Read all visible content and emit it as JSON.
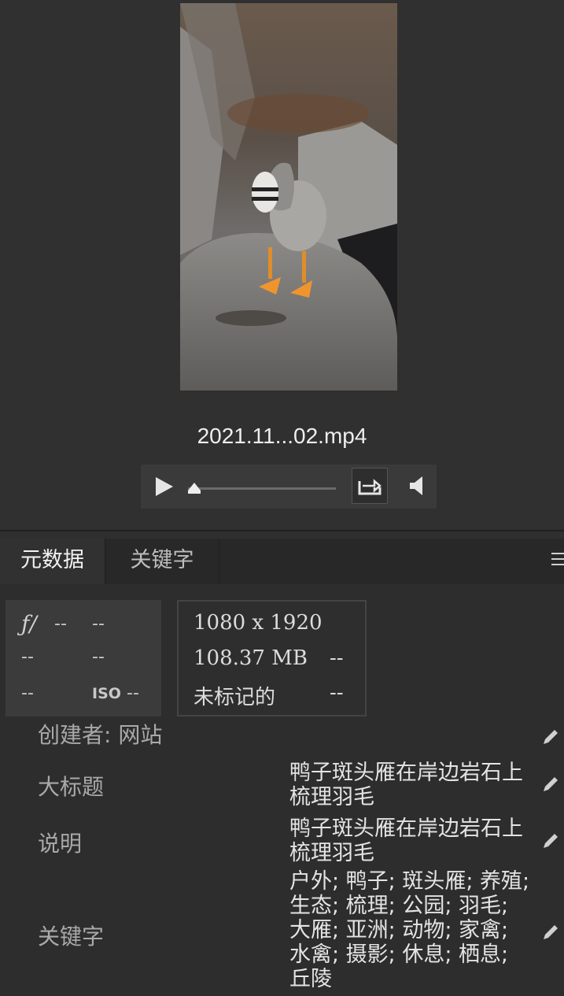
{
  "preview": {
    "filename": "2021.11...02.mp4",
    "thumbnail": "bar-headed goose on rock photo",
    "playback_progress": 0.03
  },
  "player": {
    "play_icon": "play-icon",
    "loop_icon": "loop-icon",
    "volume_icon": "volume-icon"
  },
  "tabs": [
    {
      "label": "元数据",
      "active": true
    },
    {
      "label": "关键字",
      "active": false
    }
  ],
  "camera": {
    "fstop_symbol": "ƒ/",
    "fstop": "--",
    "shutter": "--",
    "row2_a": "--",
    "row2_b": "--",
    "row3_a": "--",
    "iso_label": "ISO",
    "iso": "--"
  },
  "file_info": {
    "dimensions": "1080 x 1920",
    "size": "108.37 MB",
    "size_extra": "--",
    "label_status": "未标记的",
    "label_extra": "--"
  },
  "metadata": {
    "creator_row": "创建者: 网站",
    "headline_label": "大标题",
    "headline_value": "鸭子斑头雁在岸边岩石上梳理羽毛",
    "description_label": "说明",
    "description_value": "鸭子斑头雁在岸边岩石上梳理羽毛",
    "keywords_label": "关键字",
    "keywords_value": "户外; 鸭子; 斑头雁; 养殖; 生态; 梳理; 公园; 羽毛; 大雁; 亚洲; 动物; 家禽; 水禽; 摄影; 休息; 栖息; 丘陵"
  },
  "colors": {
    "background": "#2f2f2f",
    "tab_active": "#313131",
    "text": "#d9d9d9"
  }
}
